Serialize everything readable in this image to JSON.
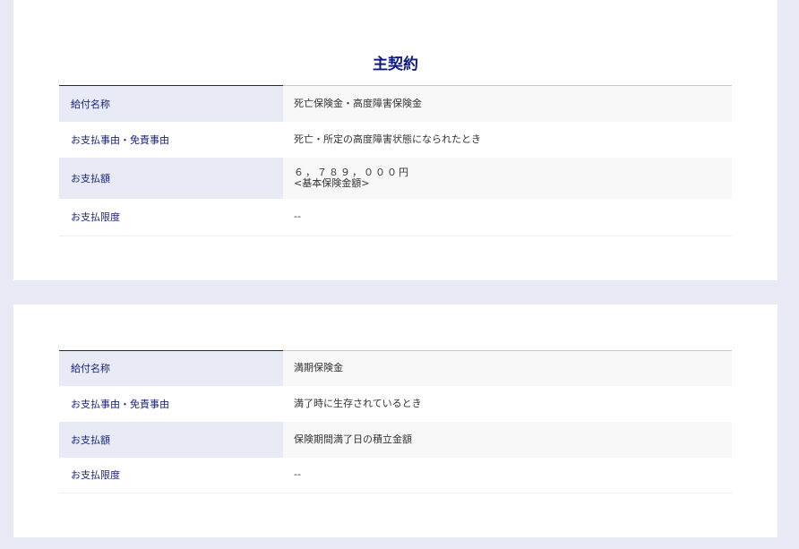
{
  "main_contract": {
    "title": "主契約",
    "rows": [
      {
        "label": "給付名称",
        "value": "死亡保険金・高度障害保険金"
      },
      {
        "label": "お支払事由・免責事由",
        "value": "死亡・所定の高度障害状態になられたとき"
      },
      {
        "label": "お支払額",
        "value_line1": "６，７８９，０００円",
        "value_line2": "<基本保険金額>"
      },
      {
        "label": "お支払限度",
        "value": "--"
      }
    ]
  },
  "second_contract": {
    "rows": [
      {
        "label": "給付名称",
        "value": "満期保険金"
      },
      {
        "label": "お支払事由・免責事由",
        "value": "満了時に生存されているとき"
      },
      {
        "label": "お支払額",
        "value": "保険期間満了日の積立金額"
      },
      {
        "label": "お支払限度",
        "value": "--"
      }
    ]
  }
}
